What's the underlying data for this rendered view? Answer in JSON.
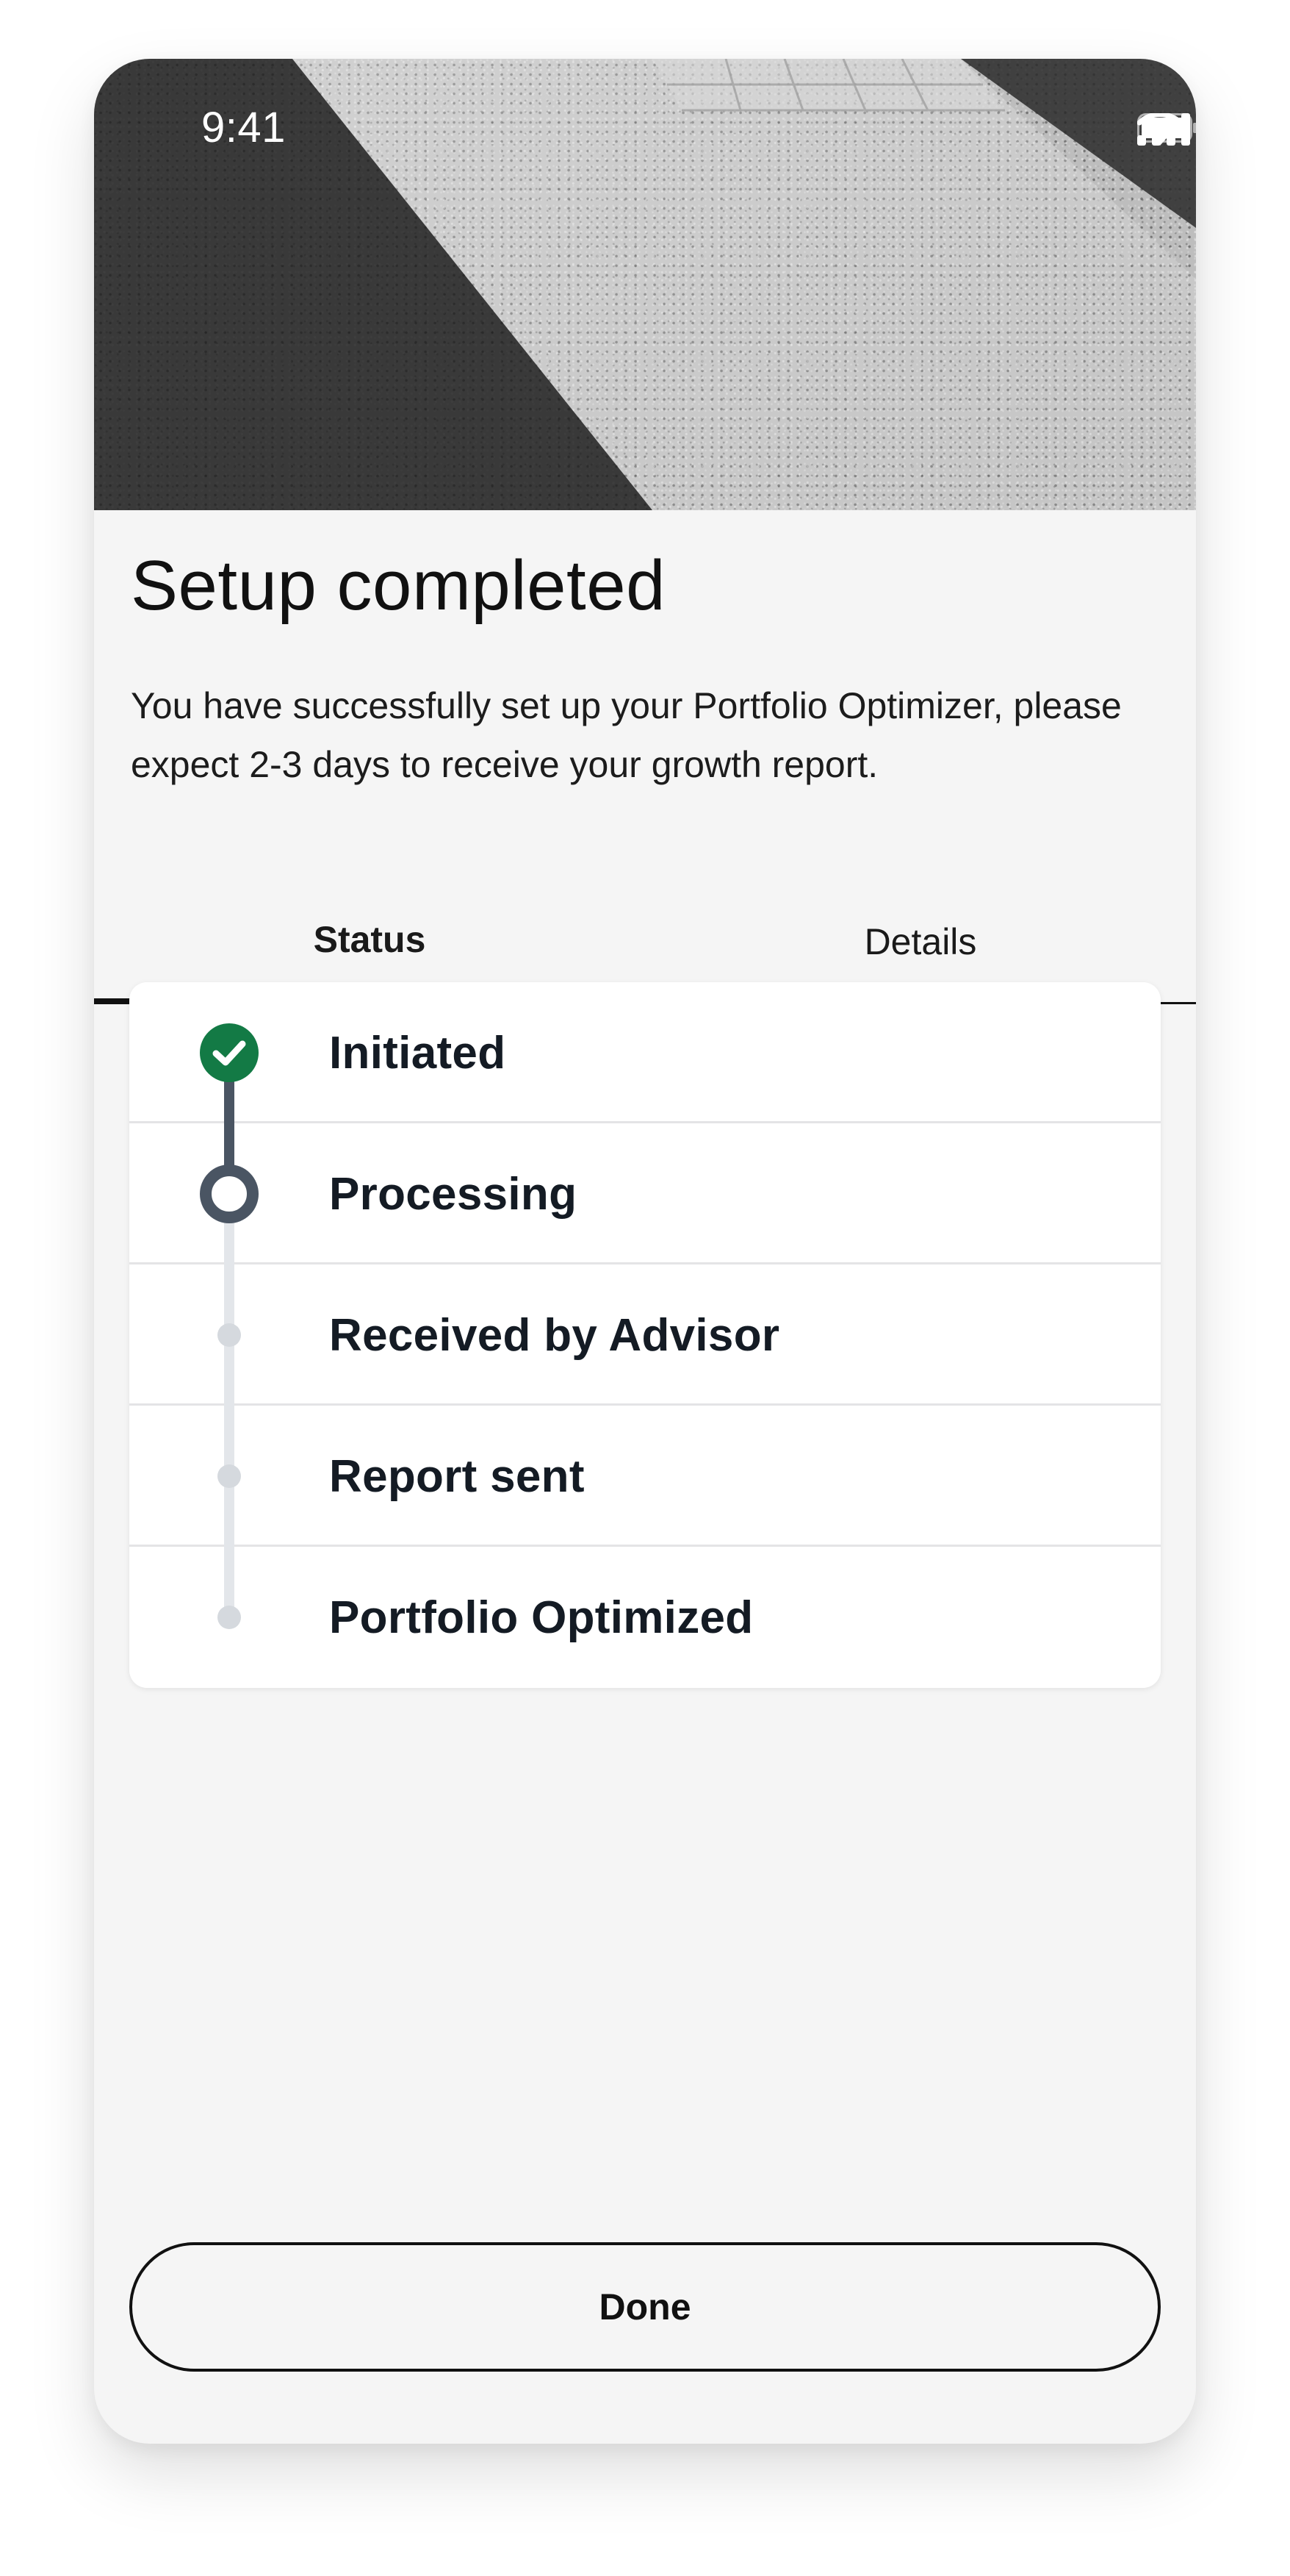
{
  "status_bar": {
    "time": "9:41",
    "icons": [
      "signal-icon",
      "wifi-icon",
      "battery-icon"
    ]
  },
  "hero": {
    "image": "gravel-pavement-photo"
  },
  "header": {
    "title": "Setup completed",
    "description": "You have successfully set up your Portfolio Optimizer, please expect 2-3 days to receive your growth report."
  },
  "tabs": [
    {
      "label": "Status",
      "active": true
    },
    {
      "label": "Details",
      "active": false
    }
  ],
  "steps": [
    {
      "label": "Initiated",
      "state": "completed"
    },
    {
      "label": "Processing",
      "state": "current"
    },
    {
      "label": "Received by Advisor",
      "state": "pending"
    },
    {
      "label": "Report sent",
      "state": "pending"
    },
    {
      "label": "Portfolio Optimized",
      "state": "pending"
    }
  ],
  "colors": {
    "completed": "#137a45",
    "current": "#4a5563",
    "pending": "#e3e6ea"
  },
  "actions": {
    "done_label": "Done"
  }
}
